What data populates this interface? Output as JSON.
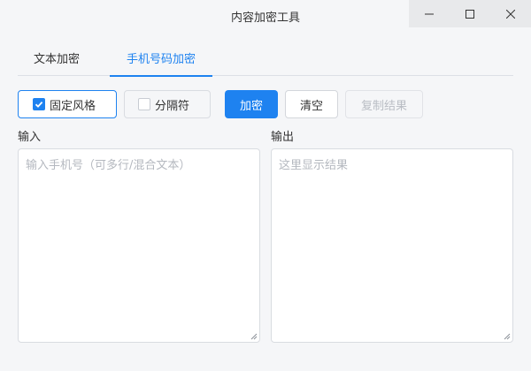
{
  "window": {
    "title": "内容加密工具"
  },
  "tabs": [
    {
      "label": "文本加密",
      "active": false
    },
    {
      "label": "手机号码加密",
      "active": true
    }
  ],
  "toolbar": {
    "fixed_style": {
      "label": "固定风格",
      "checked": true
    },
    "separator": {
      "label": "分隔符",
      "checked": false
    },
    "encrypt_label": "加密",
    "clear_label": "清空",
    "copy_label": "复制结果"
  },
  "input": {
    "label": "输入",
    "placeholder": "输入手机号（可多行/混合文本）"
  },
  "output": {
    "label": "输出",
    "placeholder": "这里显示结果"
  },
  "colors": {
    "accent": "#1e82f0",
    "background": "#f5f6f8"
  }
}
